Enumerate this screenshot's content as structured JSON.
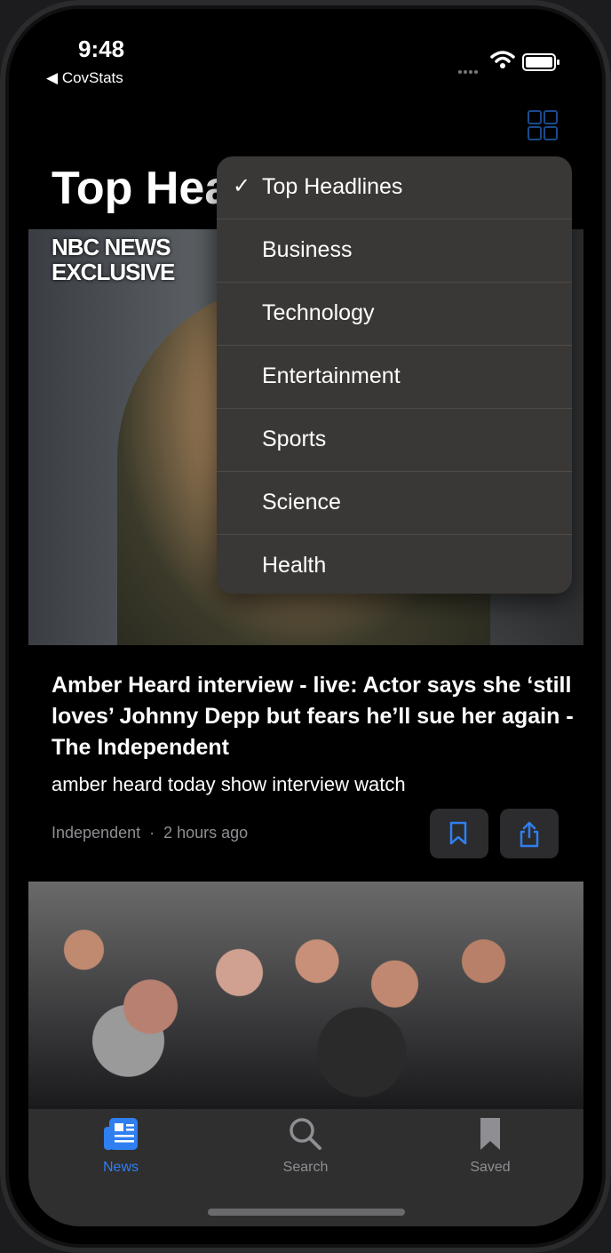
{
  "status_bar": {
    "time": "9:48",
    "back_app": "CovStats"
  },
  "page": {
    "title": "Top Hea"
  },
  "menu": {
    "items": [
      {
        "label": "Top Headlines",
        "checked": true
      },
      {
        "label": "Business",
        "checked": false
      },
      {
        "label": "Technology",
        "checked": false
      },
      {
        "label": "Entertainment",
        "checked": false
      },
      {
        "label": "Sports",
        "checked": false
      },
      {
        "label": "Science",
        "checked": false
      },
      {
        "label": "Health",
        "checked": false
      }
    ],
    "check_glyph": "✓"
  },
  "article": {
    "image_logo_line1": "NBC NEWS",
    "image_logo_line2": "EXCLUSIVE",
    "headline": "Amber Heard interview - live: Actor says she ‘still loves’ Johnny Depp but fears he’ll sue her again - The Independent",
    "description": "amber heard today show interview watch",
    "source": "Independent",
    "separator": "·",
    "time_ago": "2 hours ago"
  },
  "tabbar": {
    "tabs": [
      {
        "label": "News",
        "icon": "newspaper-icon",
        "active": true
      },
      {
        "label": "Search",
        "icon": "search-icon",
        "active": false
      },
      {
        "label": "Saved",
        "icon": "bookmark-icon",
        "active": false
      }
    ]
  },
  "colors": {
    "accent": "#2f7ff0",
    "inactive": "#8e8e93",
    "background": "#000000"
  }
}
